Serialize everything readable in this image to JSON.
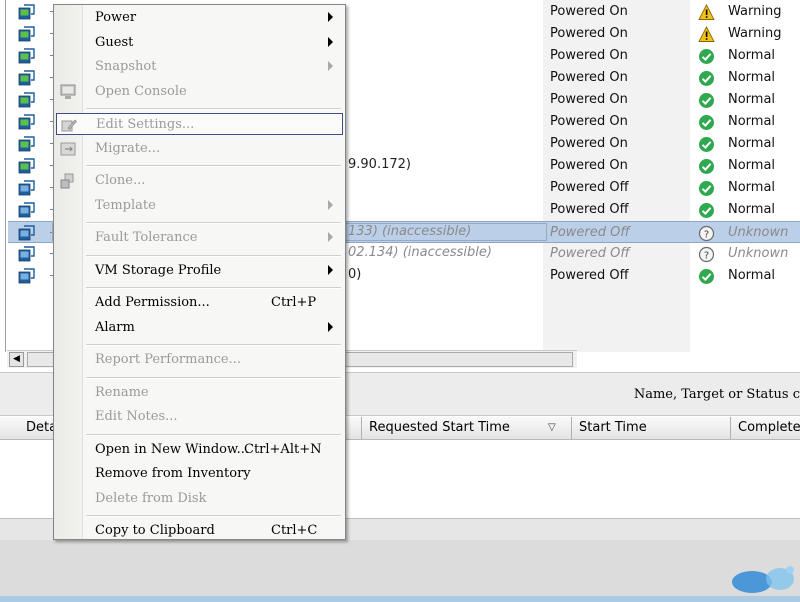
{
  "vm_list": {
    "rows": [
      {
        "name_fragment": "",
        "state": "Powered On",
        "status": "Warning",
        "status_kind": "warning",
        "power": "on"
      },
      {
        "name_fragment": "",
        "state": "Powered On",
        "status": "Warning",
        "status_kind": "warning",
        "power": "on"
      },
      {
        "name_fragment": "",
        "state": "Powered On",
        "status": "Normal",
        "status_kind": "normal",
        "power": "on"
      },
      {
        "name_fragment": "",
        "state": "Powered On",
        "status": "Normal",
        "status_kind": "normal",
        "power": "on"
      },
      {
        "name_fragment": "",
        "state": "Powered On",
        "status": "Normal",
        "status_kind": "normal",
        "power": "on"
      },
      {
        "name_fragment": "",
        "state": "Powered On",
        "status": "Normal",
        "status_kind": "normal",
        "power": "on"
      },
      {
        "name_fragment": "",
        "state": "Powered On",
        "status": "Normal",
        "status_kind": "normal",
        "power": "on"
      },
      {
        "name_fragment": "9.90.172)",
        "state": "Powered On",
        "status": "Normal",
        "status_kind": "normal",
        "power": "on"
      },
      {
        "name_fragment": "",
        "state": "Powered Off",
        "status": "Normal",
        "status_kind": "normal",
        "power": "off"
      },
      {
        "name_fragment": "",
        "state": "Powered Off",
        "status": "Normal",
        "status_kind": "normal",
        "power": "off"
      },
      {
        "name_fragment": "133) (inaccessible)",
        "state": "Powered Off",
        "status": "Unknown",
        "status_kind": "unknown",
        "power": "off",
        "selected": true
      },
      {
        "name_fragment": "02.134) (inaccessible)",
        "state": "Powered Off",
        "status": "Unknown",
        "status_kind": "unknown",
        "power": "off"
      },
      {
        "name_fragment": "0)",
        "state": "Powered Off",
        "status": "Normal",
        "status_kind": "normal",
        "power": "off"
      }
    ]
  },
  "context_menu": {
    "items": [
      {
        "label": "Power",
        "enabled": true,
        "submenu": true
      },
      {
        "label": "Guest",
        "enabled": true,
        "submenu": true
      },
      {
        "label": "Snapshot",
        "enabled": false,
        "submenu": true
      },
      {
        "label": "Open Console",
        "enabled": false,
        "icon": "console-icon"
      },
      {
        "sep": true
      },
      {
        "label": "Edit Settings...",
        "enabled": false,
        "highlighted": true,
        "icon": "edit-settings-icon"
      },
      {
        "label": "Migrate...",
        "enabled": false,
        "icon": "migrate-icon"
      },
      {
        "sep": true
      },
      {
        "label": "Clone...",
        "enabled": false,
        "icon": "clone-icon"
      },
      {
        "label": "Template",
        "enabled": false,
        "submenu": true
      },
      {
        "sep": true
      },
      {
        "label": "Fault Tolerance",
        "enabled": false,
        "submenu": true
      },
      {
        "sep": true
      },
      {
        "label": "VM Storage Profile",
        "enabled": true,
        "submenu": true
      },
      {
        "sep": true
      },
      {
        "label": "Add Permission...",
        "enabled": true,
        "shortcut": "Ctrl+P"
      },
      {
        "label": "Alarm",
        "enabled": true,
        "submenu": true
      },
      {
        "sep": true
      },
      {
        "label": "Report Performance...",
        "enabled": false
      },
      {
        "sep": true
      },
      {
        "label": "Rename",
        "enabled": false
      },
      {
        "label": "Edit Notes...",
        "enabled": false
      },
      {
        "sep": true
      },
      {
        "label": "Open in New Window...",
        "enabled": true,
        "shortcut": "Ctrl+Alt+N"
      },
      {
        "label": "Remove from Inventory",
        "enabled": true
      },
      {
        "label": "Delete from Disk",
        "enabled": false
      },
      {
        "sep": true
      },
      {
        "label": "Copy to Clipboard",
        "enabled": true,
        "shortcut": "Ctrl+C"
      }
    ]
  },
  "lower_pane": {
    "filter_label": "Name, Target or Status c",
    "columns": [
      "Deta",
      "Requested Start Time",
      "Start Time",
      "Completed"
    ]
  },
  "colors": {
    "selection": "#bccfe8",
    "normal_status": "#2fa84f",
    "warning_status": "#f2c21a",
    "menu_highlight_border": "#3f4f86"
  }
}
